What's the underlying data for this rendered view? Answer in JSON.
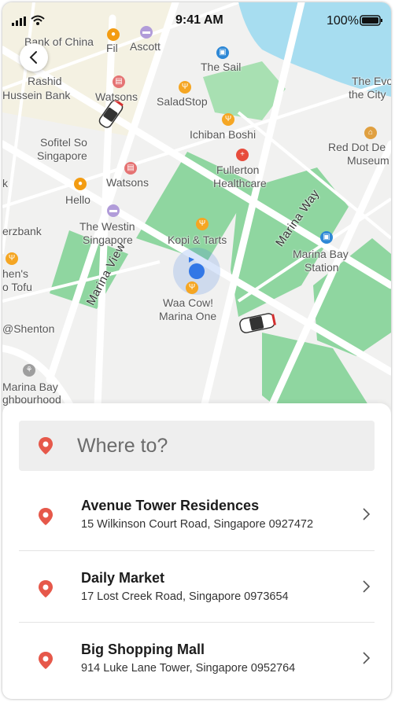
{
  "status_bar": {
    "time": "9:41 AM",
    "battery": "100%"
  },
  "map": {
    "places": [
      "Bank of China",
      "Fil",
      "Ascott",
      "The Sail",
      "Rashid",
      "Hussein Bank",
      "Watsons",
      "SaladStop",
      "The Evo",
      "the City",
      "Ichiban Boshi",
      "Sofitel So",
      "Singapore",
      "Red Dot De",
      "Museum",
      "Fullerton",
      "Healthcare",
      "Watsons",
      "Hello",
      "The Westin",
      "Singapore",
      "Kopi & Tarts",
      "Marina Bay",
      "Station",
      "Waa Cow!",
      "Marina One",
      "@Shenton",
      "Marina Bay",
      "ghbourhood",
      "erzbank",
      "hen's",
      "o Tofu",
      "k"
    ],
    "roads": [
      "Marina Way",
      "Marina View"
    ]
  },
  "search": {
    "placeholder": "Where to?"
  },
  "destinations": [
    {
      "name": "Avenue Tower Residences",
      "address": "15 Wilkinson Court Road, Singapore 0927472"
    },
    {
      "name": "Daily Market",
      "address": "17 Lost Creek Road, Singapore 0973654"
    },
    {
      "name": "Big Shopping Mall",
      "address": "914 Luke Lane Tower, Singapore 0952764"
    }
  ],
  "colors": {
    "accent": "#e6584a",
    "park": "#8fd6a0",
    "water": "#a7ddf0",
    "location": "#3277e6"
  }
}
